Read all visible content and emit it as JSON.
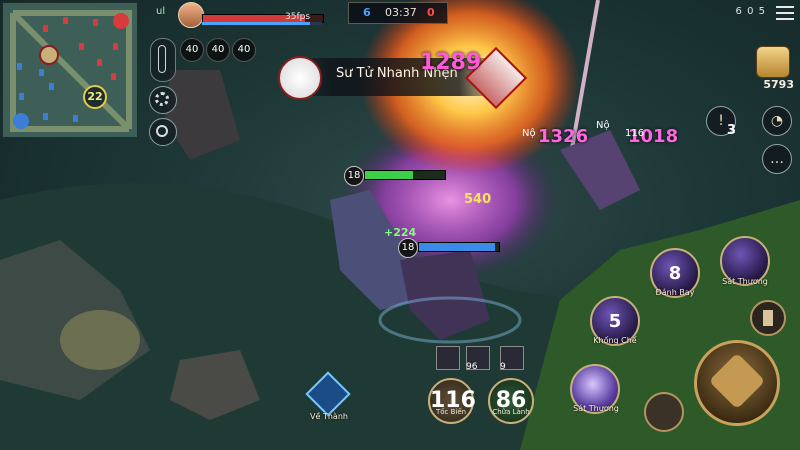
{
  "hud": {
    "fps": "35fps",
    "signal": "ul",
    "cooldowns": [
      "40",
      "40",
      "40"
    ]
  },
  "score": {
    "blue": "6",
    "time": "03:37",
    "red": "0"
  },
  "top_stats": "6   0   5",
  "gold": "5793",
  "kill_banner": {
    "label": "Sư Tử Nhanh Nhẹn"
  },
  "combat_text": {
    "dmg1": "1289",
    "dmg2": "1326",
    "dmg3": "1018",
    "dmg_small": "116",
    "no1": "Nộ",
    "no2": "Nộ",
    "heal": "+224",
    "gold_pop": "540"
  },
  "units": {
    "enemy_level": "18",
    "self_level": "18"
  },
  "side": {
    "alert_count": "3"
  },
  "skills": {
    "s1": {
      "num": "8",
      "label": "Đánh Bay"
    },
    "s2": {
      "label": "Sát Thương"
    },
    "s3": {
      "num": "5",
      "label": "Khống Chế"
    },
    "s4": {
      "label": "Sát Thương"
    },
    "recall": {
      "label": "Về Thành"
    },
    "flash": {
      "num": "116",
      "label": "Tốc Biến"
    },
    "heal": {
      "num": "86",
      "label": "Chữa Lành"
    }
  },
  "items": [
    {
      "count": ""
    },
    {
      "count": "96"
    },
    {
      "count": "9"
    }
  ],
  "colors": {
    "blue_team": "#4fa2ff",
    "red_team": "#ff4e4e",
    "damage": "#ff5bd9",
    "accent_gold": "#c9a15a"
  }
}
